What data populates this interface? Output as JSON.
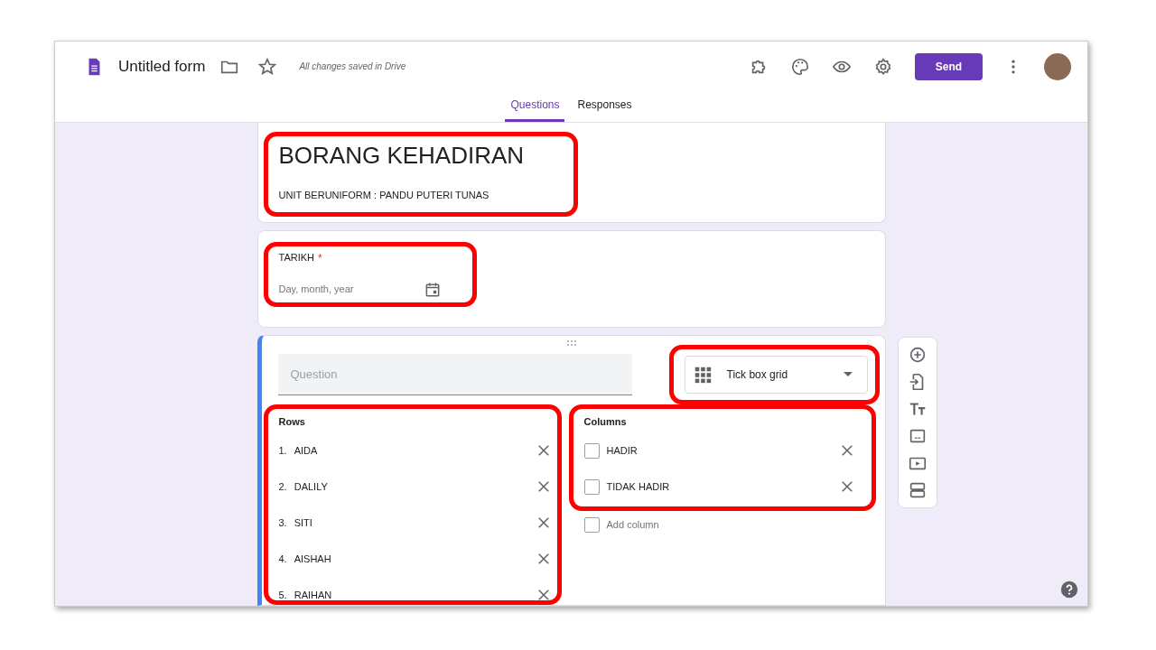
{
  "header": {
    "title": "Untitled form",
    "save_status": "All changes saved in Drive",
    "send_button": "Send"
  },
  "tabs": [
    {
      "label": "Questions",
      "selected": true
    },
    {
      "label": "Responses",
      "selected": false
    }
  ],
  "form_header": {
    "title": "BORANG KEHADIRAN",
    "description": "UNIT BERUNIFORM : PANDU PUTERI TUNAS",
    "highlighted": true
  },
  "date_question": {
    "title": "TARIKH",
    "required": true,
    "required_mark": "*",
    "placeholder": "Day, month, year",
    "highlighted": true
  },
  "grid_question": {
    "placeholder": "Question",
    "type": {
      "label": "Tick box grid",
      "highlighted": true
    },
    "rows_label": "Rows",
    "rows_highlighted": true,
    "rows": [
      {
        "number": "1.",
        "label": "AIDA"
      },
      {
        "number": "2.",
        "label": "DALILY"
      },
      {
        "number": "3.",
        "label": "SITI"
      },
      {
        "number": "4.",
        "label": "AISHAH"
      },
      {
        "number": "5.",
        "label": "RAIHAN"
      }
    ],
    "columns_label": "Columns",
    "columns_highlighted": true,
    "columns": [
      {
        "label": "HADIR",
        "checked": false
      },
      {
        "label": "TIDAK HADIR",
        "checked": false
      }
    ],
    "add_column": {
      "label": "Add column",
      "checked": false
    }
  }
}
